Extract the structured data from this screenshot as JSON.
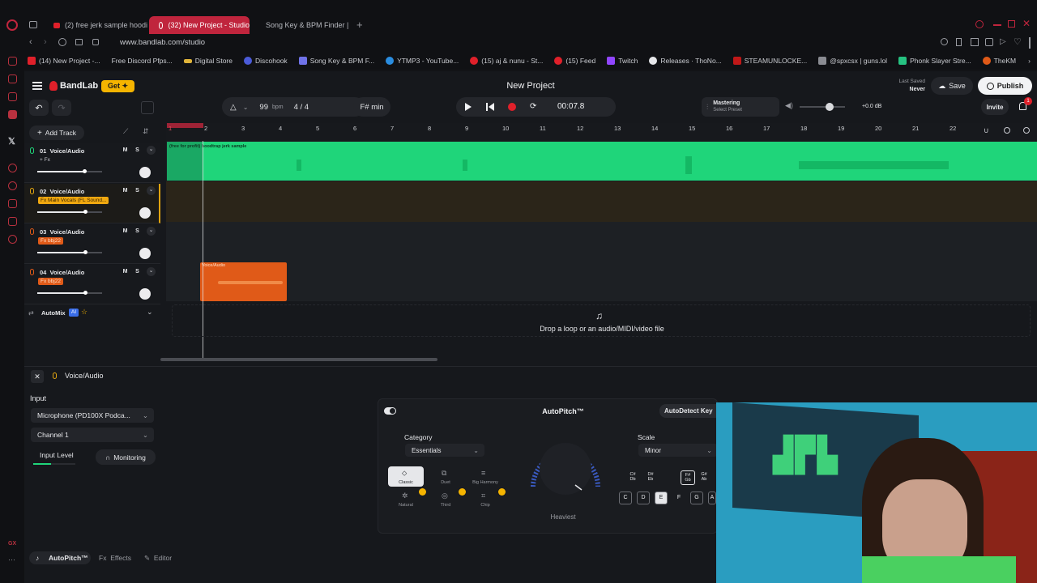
{
  "browser": {
    "tabs": [
      {
        "label": "(2) free jerk sample hoodi",
        "active": false
      },
      {
        "label": "(32) New Project - Studio",
        "active": true
      },
      {
        "label": "Song Key & BPM Finder | T",
        "active": false
      }
    ],
    "new_tab": "+",
    "url": "www.bandlab.com/studio",
    "bookmarks": [
      {
        "label": "(14) New Project -..."
      },
      {
        "label": "Free Discord Pfps..."
      },
      {
        "label": "Digital Store"
      },
      {
        "label": "Discohook"
      },
      {
        "label": "Song Key & BPM F..."
      },
      {
        "label": "YTMP3 - YouTube..."
      },
      {
        "label": "(15) aj & nunu - St..."
      },
      {
        "label": "(15) Feed"
      },
      {
        "label": "Twitch"
      },
      {
        "label": "Releases · ThoNo..."
      },
      {
        "label": "STEAMUNLOCKE..."
      },
      {
        "label": "@spxcsx | guns.lol"
      },
      {
        "label": "Phonk Slayer Stre..."
      },
      {
        "label": "TheKM"
      }
    ],
    "sidebar_gx": "GX"
  },
  "header": {
    "brand": "BandLab",
    "get_label": "Get",
    "project_title": "New Project",
    "last_saved_label": "Last Saved",
    "last_saved_value": "Never",
    "save_label": "Save",
    "publish_label": "Publish"
  },
  "toolbar": {
    "bpm_value": "99",
    "bpm_unit": "bpm",
    "time_signature": "4 / 4",
    "key": "F# min",
    "time": "00:07.8",
    "mastering_label": "Mastering",
    "mastering_preset": "Select Preset",
    "master_volume": "+0.0 dB",
    "invite_label": "Invite",
    "notification_count": "1"
  },
  "tracklist": {
    "add_track": "Add Track",
    "tracks": [
      {
        "num": "01",
        "name": "Voice/Audio",
        "fx": "+ Fx",
        "fx_style": "plain",
        "m": "M",
        "s": "S",
        "volume": 0.72
      },
      {
        "num": "02",
        "name": "Voice/Audio",
        "fx": "Fx Main Vocals (FL Sound...",
        "fx_style": "yellow",
        "m": "M",
        "s": "S",
        "volume": 0.74
      },
      {
        "num": "03",
        "name": "Voice/Audio",
        "fx": "Fx bbj22",
        "fx_style": "orange",
        "m": "M",
        "s": "S",
        "volume": 0.74
      },
      {
        "num": "04",
        "name": "Voice/Audio",
        "fx": "Fx bbj22",
        "fx_style": "orange",
        "m": "M",
        "s": "S",
        "volume": 0.74
      }
    ],
    "automix": "AutoMix",
    "ai_badge": "AI"
  },
  "timeline": {
    "bars": [
      "1",
      "2",
      "3",
      "4",
      "5",
      "6",
      "7",
      "8",
      "9",
      "10",
      "11",
      "12",
      "13",
      "14",
      "15",
      "16",
      "17",
      "18",
      "19",
      "20",
      "21",
      "22"
    ],
    "clip1_name": "(free for profit) hoodtrap jerk sample",
    "clip4_name": "Voice/Audio",
    "drop_hint": "Drop a loop or an audio/MIDI/video file"
  },
  "panel": {
    "title": "Voice/Audio",
    "input_label": "Input",
    "input_device": "Microphone (PD100X Podca...",
    "channel": "Channel 1",
    "input_level_label": "Input Level",
    "monitoring_label": "Monitoring",
    "tabs": {
      "autopitch": "AutoPitch™",
      "effects": "Effects",
      "editor": "Editor"
    }
  },
  "autopitch": {
    "title": "AutoPitch™",
    "autodetect": "AutoDetect Key",
    "category_label": "Category",
    "category_value": "Essentials",
    "scale_label": "Scale",
    "scale_value": "Minor",
    "knob_label": "Heaviest",
    "options": [
      "Classic",
      "Duet",
      "Big Harmony",
      "Natural",
      "Third",
      "Chip"
    ],
    "sharp_keys": [
      "C#\nDb",
      "D#\nEb",
      "F#\nGb",
      "G#\nAb"
    ],
    "natural_keys": [
      "C",
      "D",
      "E",
      "F",
      "G",
      "A"
    ]
  },
  "colors": {
    "accent_red": "#c0253d",
    "waveform_green": "#1fd57a",
    "clip_orange": "#e05a18",
    "record_red": "#e0202a",
    "get_yellow": "#f5b400"
  }
}
